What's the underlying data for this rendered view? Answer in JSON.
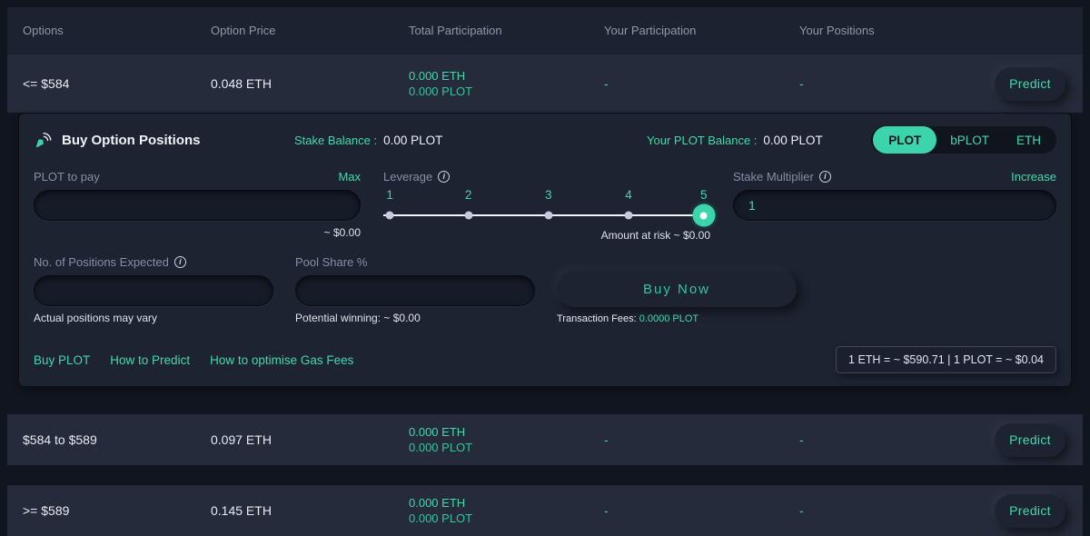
{
  "colors": {
    "accent": "#41d9ac",
    "toggle_active_bg": "#3bd4ab",
    "row_bg": "#252b3a",
    "panel_bg": "#1d2331"
  },
  "icons": {
    "info_glyph": "i",
    "buy_positions": "click-arrow-icon"
  },
  "table": {
    "headers": [
      "Options",
      "Option Price",
      "Total Participation",
      "Your Participation",
      "Your Positions"
    ],
    "predict_label": "Predict",
    "rows": [
      {
        "option": "<= $584",
        "price": "0.048 ETH",
        "total_eth": "0.000 ETH",
        "total_plot": "0.000 PLOT",
        "your_participation": "-",
        "your_positions": "-"
      },
      {
        "option": "$584 to $589",
        "price": "0.097 ETH",
        "total_eth": "0.000 ETH",
        "total_plot": "0.000 PLOT",
        "your_participation": "-",
        "your_positions": "-"
      },
      {
        "option": ">= $589",
        "price": "0.145 ETH",
        "total_eth": "0.000 ETH",
        "total_plot": "0.000 PLOT",
        "your_participation": "-",
        "your_positions": "-"
      }
    ]
  },
  "panel": {
    "title": "Buy Option Positions",
    "stake_balance_label": "Stake Balance :",
    "stake_balance_value": "0.00 PLOT",
    "plot_balance_label": "Your PLOT Balance :",
    "plot_balance_value": "0.00 PLOT",
    "currency_toggle": {
      "options": [
        "PLOT",
        "bPLOT",
        "ETH"
      ],
      "selected": "PLOT"
    },
    "pay": {
      "label": "PLOT to pay",
      "max_label": "Max",
      "value": "",
      "usd_estimate": "~ $0.00"
    },
    "leverage": {
      "label": "Leverage",
      "levels": [
        "1",
        "2",
        "3",
        "4",
        "5"
      ],
      "selected": "5",
      "risk_label": "Amount at risk ~ $0.00"
    },
    "stake_multiplier": {
      "label": "Stake Multiplier",
      "increase_label": "Increase",
      "value": "1"
    },
    "positions_expected": {
      "label": "No. of Positions Expected",
      "value": "",
      "note": "Actual positions may vary"
    },
    "pool_share": {
      "label": "Pool Share %",
      "value": "",
      "note": "Potential winning: ~ $0.00"
    },
    "buy_now_label": "Buy Now",
    "transaction_fees_label": "Transaction Fees:",
    "transaction_fees_value": "0.0000 PLOT",
    "links": [
      "Buy PLOT",
      "How to Predict",
      "How to optimise Gas Fees"
    ],
    "rates": "1 ETH = ~ $590.71   |   1 PLOT = ~ $0.04"
  }
}
